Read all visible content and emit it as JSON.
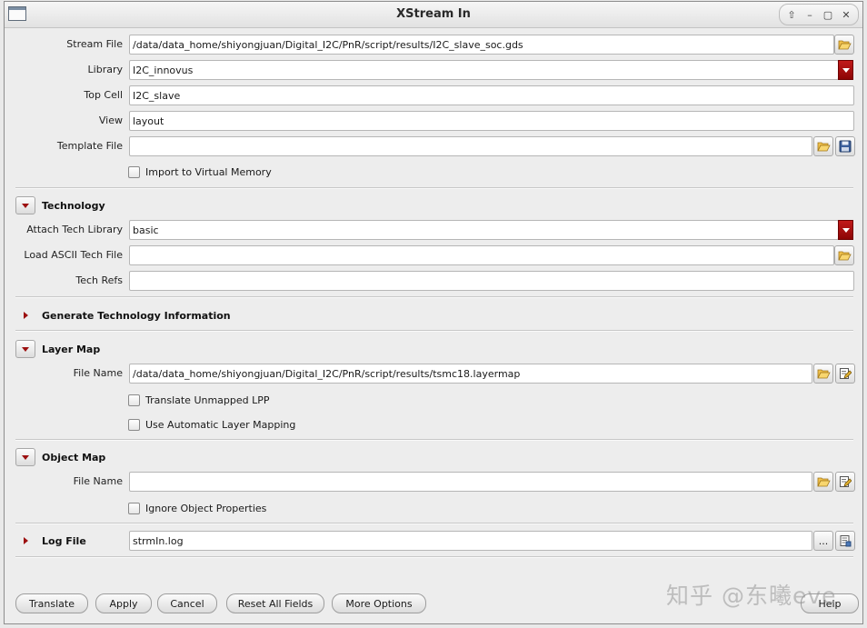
{
  "window": {
    "title": "XStream In"
  },
  "fields": {
    "stream_file": {
      "label": "Stream File",
      "value": "/data/data_home/shiyongjuan/Digital_I2C/PnR/script/results/I2C_slave_soc.gds"
    },
    "library": {
      "label": "Library",
      "value": "I2C_innovus"
    },
    "top_cell": {
      "label": "Top Cell",
      "value": "I2C_slave"
    },
    "view": {
      "label": "View",
      "value": "layout"
    },
    "template_file": {
      "label": "Template File",
      "value": ""
    },
    "import_virtual_memory": {
      "label": "Import to Virtual Memory",
      "checked": false
    }
  },
  "technology": {
    "title": "Technology",
    "attach_tech_library": {
      "label": "Attach Tech Library",
      "value": "basic"
    },
    "load_ascii_tech_file": {
      "label": "Load ASCII Tech File",
      "value": ""
    },
    "tech_refs": {
      "label": "Tech Refs",
      "value": ""
    }
  },
  "generate_tech_info": {
    "title": "Generate Technology Information"
  },
  "layer_map": {
    "title": "Layer Map",
    "file_name": {
      "label": "File Name",
      "value": "/data/data_home/shiyongjuan/Digital_I2C/PnR/script/results/tsmc18.layermap"
    },
    "translate_unmapped_lpp": {
      "label": "Translate Unmapped LPP",
      "checked": false
    },
    "use_auto_layer_mapping": {
      "label": "Use Automatic Layer Mapping",
      "checked": false
    }
  },
  "object_map": {
    "title": "Object Map",
    "file_name": {
      "label": "File Name",
      "value": ""
    },
    "ignore_object_properties": {
      "label": "Ignore Object Properties",
      "checked": false
    }
  },
  "log_file": {
    "title": "Log File",
    "value": "strmIn.log",
    "browse_label": "..."
  },
  "buttons": {
    "translate": "Translate",
    "apply": "Apply",
    "cancel": "Cancel",
    "reset_all_fields": "Reset All Fields",
    "more_options": "More Options",
    "help": "Help"
  },
  "watermark": "知乎 @东曦eve",
  "icons": {
    "folder": "folder-open-icon",
    "save": "floppy-disk-icon",
    "edit": "edit-file-icon",
    "log": "log-file-icon"
  },
  "colors": {
    "dropdown_accent": "#a30d0d",
    "toggle_arrow": "#9c1010"
  }
}
